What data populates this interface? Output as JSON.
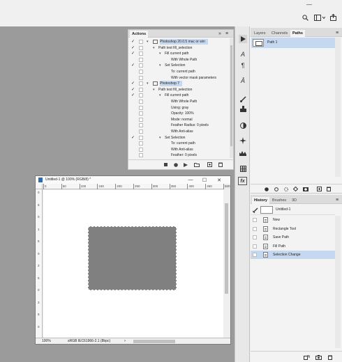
{
  "app": {
    "accent": "#c6d8ef",
    "workspace_color": "#9b9b9b"
  },
  "topbar": {
    "icons": [
      "minimize-icon",
      "search-icon",
      "workspace-icon",
      "share-icon"
    ]
  },
  "actions_panel": {
    "tab_label": "Actions",
    "menu_glyph": "≡",
    "collapse_glyph": "»",
    "rows": [
      {
        "check": "✓",
        "indent": 0,
        "expand": "▾",
        "folder": true,
        "text": "Photoshop 20.0.5 mac or win",
        "selected": true
      },
      {
        "check": "✓",
        "indent": 1,
        "expand": "▾",
        "folder": false,
        "text": "Path test fill_selection",
        "selected": false
      },
      {
        "check": "✓",
        "indent": 2,
        "expand": "▾",
        "folder": false,
        "text": "Fill current path",
        "selected": false
      },
      {
        "check": "",
        "indent": 3,
        "expand": "",
        "folder": false,
        "text": "With Whole Path",
        "selected": false
      },
      {
        "check": "✓",
        "indent": 2,
        "expand": "▾",
        "folder": false,
        "text": "Set Selection",
        "selected": false
      },
      {
        "check": "",
        "indent": 3,
        "expand": "",
        "folder": false,
        "text": "To: current path",
        "selected": false
      },
      {
        "check": "",
        "indent": 3,
        "expand": "",
        "folder": false,
        "text": "With vector mask parameters",
        "selected": false
      },
      {
        "check": "✓",
        "indent": 0,
        "expand": "▾",
        "folder": true,
        "text": "Photoshop 7",
        "selected": true
      },
      {
        "check": "✓",
        "indent": 1,
        "expand": "▾",
        "folder": false,
        "text": "Path test fill_selection",
        "selected": false
      },
      {
        "check": "✓",
        "indent": 2,
        "expand": "▾",
        "folder": false,
        "text": "Fill current path",
        "selected": false
      },
      {
        "check": "",
        "indent": 3,
        "expand": "",
        "folder": false,
        "text": "With Whole Path",
        "selected": false
      },
      {
        "check": "",
        "indent": 3,
        "expand": "",
        "folder": false,
        "text": "Using: gray",
        "selected": false
      },
      {
        "check": "",
        "indent": 3,
        "expand": "",
        "folder": false,
        "text": "Opacity: 100%",
        "selected": false
      },
      {
        "check": "",
        "indent": 3,
        "expand": "",
        "folder": false,
        "text": "Mode: normal",
        "selected": false
      },
      {
        "check": "",
        "indent": 3,
        "expand": "",
        "folder": false,
        "text": "Feather Radius: 0 pixels",
        "selected": false
      },
      {
        "check": "",
        "indent": 3,
        "expand": "",
        "folder": false,
        "text": "With Anti-alias",
        "selected": false
      },
      {
        "check": "✓",
        "indent": 2,
        "expand": "▾",
        "folder": false,
        "text": "Set Selection",
        "selected": false
      },
      {
        "check": "",
        "indent": 3,
        "expand": "",
        "folder": false,
        "text": "To: current path",
        "selected": false
      },
      {
        "check": "",
        "indent": 3,
        "expand": "",
        "folder": false,
        "text": "With Anti-alias",
        "selected": false
      },
      {
        "check": "",
        "indent": 3,
        "expand": "",
        "folder": false,
        "text": "Feather: 0 pixels",
        "selected": false
      }
    ],
    "footer_icons": [
      "stop-icon",
      "record-icon",
      "play-icon",
      "new-set-folder-icon",
      "new-action-icon",
      "delete-icon"
    ]
  },
  "tool_column": {
    "icons": [
      "play-panel-icon",
      "character-icon",
      "paragraph-icon",
      "glyphs-icon",
      "brush-icon",
      "clone-source-icon",
      "adjustments-icon",
      "shapes-icon",
      "styles-icon",
      "table-icon",
      "fx-icon"
    ]
  },
  "paths_panel": {
    "tabs": [
      "Layers",
      "Channels",
      "Paths"
    ],
    "active_tab": "Paths",
    "menu_glyph": "≡",
    "rows": [
      {
        "name": "Path 1",
        "selected": true
      }
    ],
    "footer_icons": [
      "fill-path-icon",
      "stroke-path-icon",
      "load-as-selection-icon",
      "make-work-path-icon",
      "add-mask-icon",
      "new-path-icon",
      "delete-path-icon"
    ]
  },
  "history_panel": {
    "tabs": [
      "History",
      "Brushes",
      "3D"
    ],
    "active_tab": "History",
    "menu_glyph": "≡",
    "snapshot_name": "Untitled-1",
    "states": [
      {
        "name": "New",
        "selected": false
      },
      {
        "name": "Rectangle Tool",
        "selected": false
      },
      {
        "name": "Save Path",
        "selected": false
      },
      {
        "name": "Fill Path",
        "selected": false
      },
      {
        "name": "Selection Change",
        "selected": true
      }
    ],
    "footer_icons": [
      "new-document-from-state-icon",
      "snapshot-camera-icon",
      "delete-state-icon"
    ]
  },
  "document": {
    "title": "Untitled-1 @ 100% (RGB/8) *",
    "window_controls": {
      "minimize": "—",
      "maximize": "☐",
      "close": "✕"
    },
    "ruler_top": [
      "0",
      "50",
      "100",
      "150",
      "200",
      "250",
      "300",
      "350",
      "400",
      "450",
      "500"
    ],
    "ruler_left": [
      "0",
      "5",
      "0",
      "1",
      "5",
      "0",
      "2",
      "5",
      "0",
      "3",
      "5",
      "0"
    ],
    "zoom": "100%",
    "color_profile": "sRGB IEC61966-2.1 (8bpc)",
    "status_arrow": "›",
    "fill_color": "#808080"
  }
}
